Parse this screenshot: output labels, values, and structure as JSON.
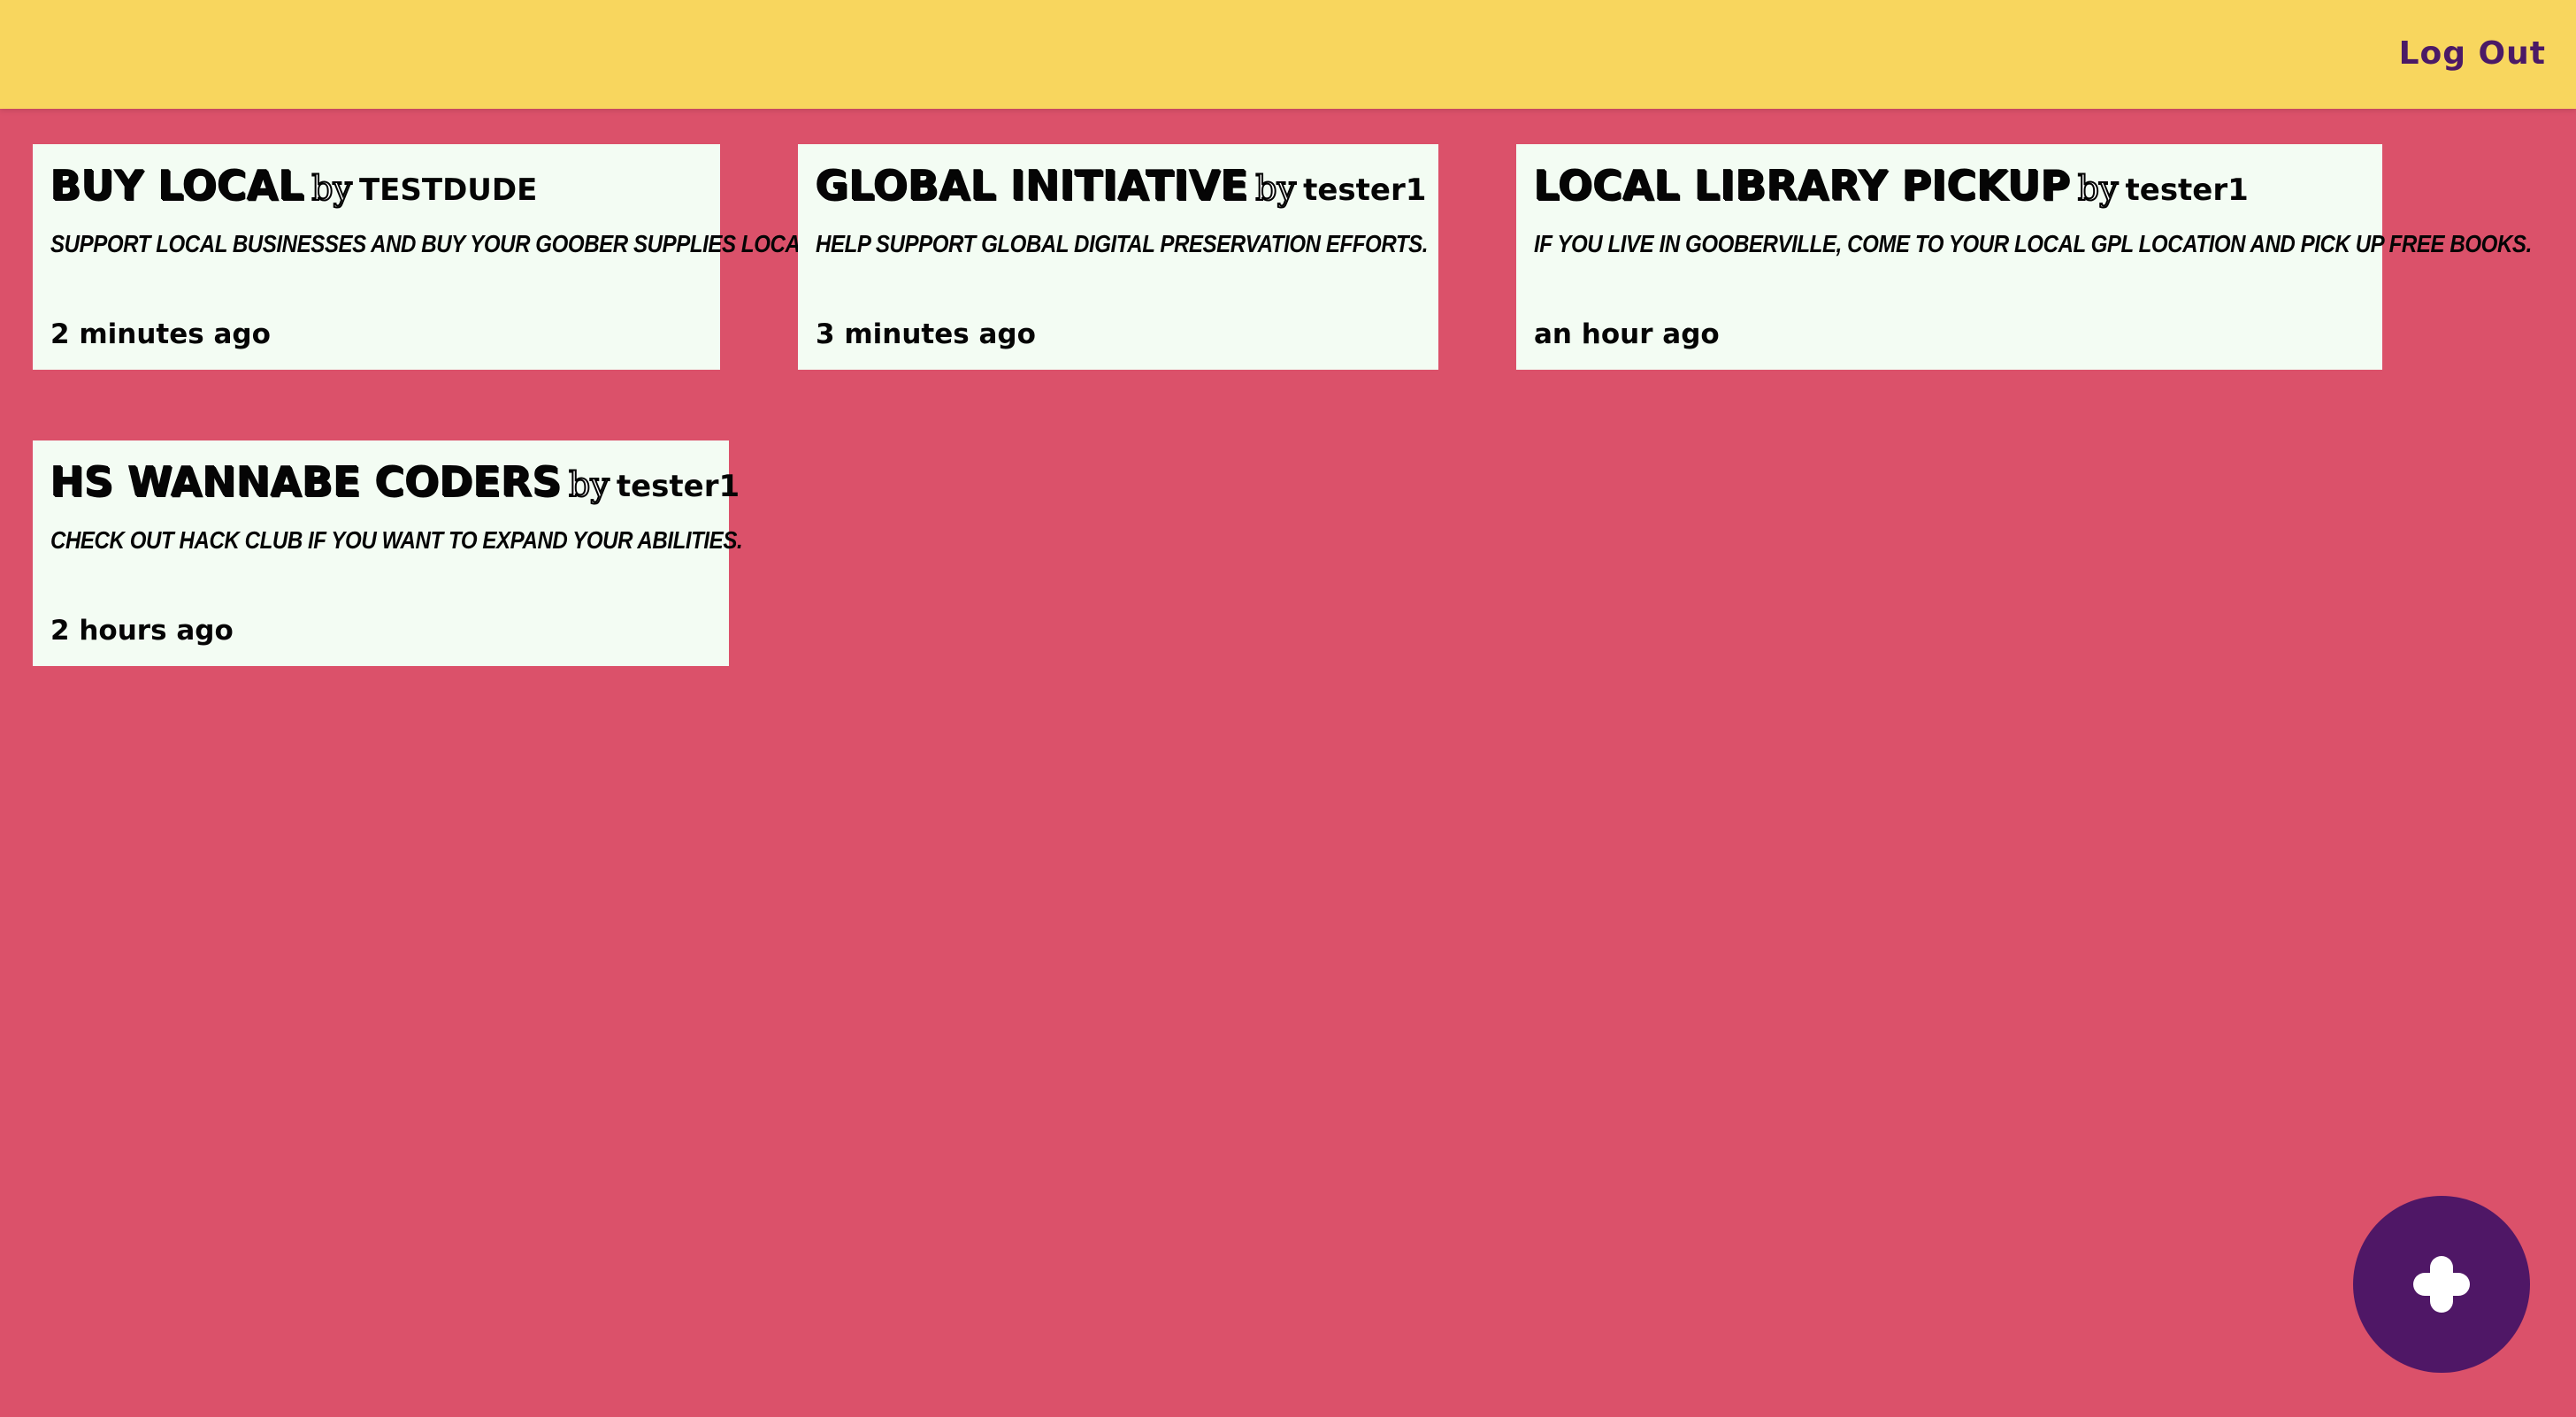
{
  "header": {
    "logout_label": "Log Out",
    "background_color": "#f8d65e"
  },
  "page": {
    "background_color": "#db516a"
  },
  "posts": [
    {
      "title": "BUY LOCAL",
      "by": "by",
      "author": "TESTDUDE",
      "description": "SUPPORT LOCAL BUSINESSES AND BUY YOUR GOOBER SUPPLIES LOCALLY.",
      "time": "2 minutes ago"
    },
    {
      "title": "GLOBAL INITIATIVE",
      "by": "by",
      "author": "tester1",
      "description": "HELP SUPPORT GLOBAL DIGITAL PRESERVATION EFFORTS.",
      "time": "3 minutes ago"
    },
    {
      "title": "LOCAL LIBRARY PICKUP",
      "by": "by",
      "author": "tester1",
      "description": "IF YOU LIVE IN GOOBERVILLE, COME TO YOUR LOCAL GPL LOCATION AND PICK UP FREE BOOKS.",
      "time": "an hour ago"
    },
    {
      "title": "HS WANNABE CODERS",
      "by": "by",
      "author": "tester1",
      "description": "CHECK OUT HACK CLUB IF YOU WANT TO EXPAND YOUR ABILITIES.",
      "time": "2 hours ago"
    }
  ],
  "fab": {
    "icon": "plus-icon",
    "color": "#4f1766"
  }
}
